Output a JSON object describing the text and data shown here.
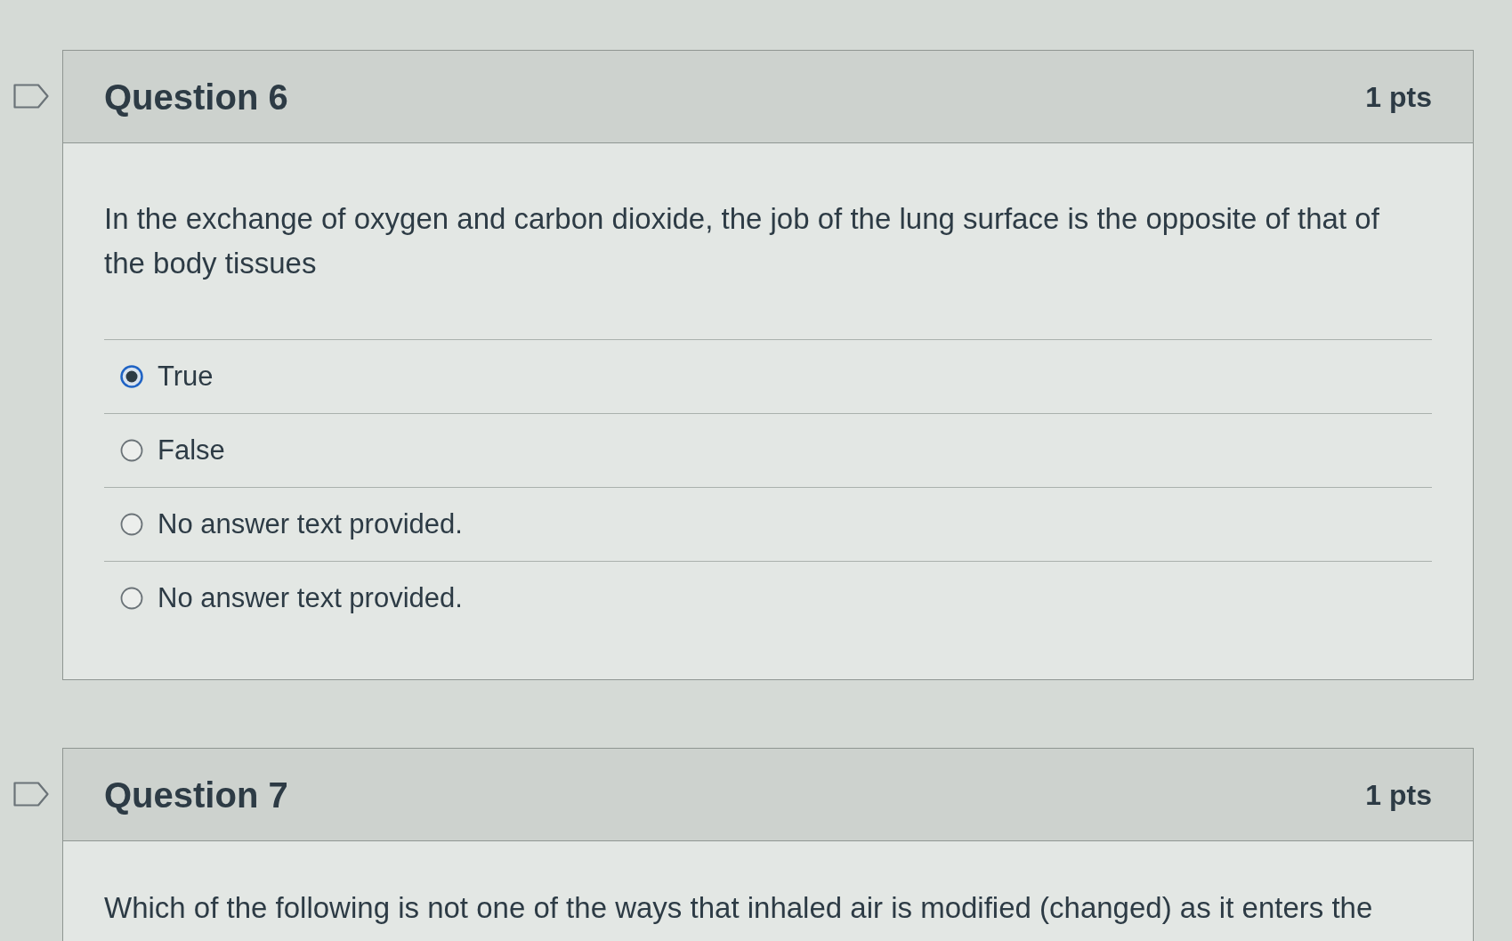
{
  "questions": [
    {
      "title": "Question 6",
      "points": "1 pts",
      "flagged": false,
      "text": "In the exchange of oxygen and carbon dioxide, the job of the lung surface is the opposite of that of the body tissues",
      "answers": [
        {
          "label": "True",
          "selected": true
        },
        {
          "label": "False",
          "selected": false
        },
        {
          "label": "No answer text provided.",
          "selected": false
        },
        {
          "label": "No answer text provided.",
          "selected": false
        }
      ]
    },
    {
      "title": "Question 7",
      "points": "1 pts",
      "flagged": false,
      "text": "Which of the following is not one of the ways that inhaled air is modified (changed) as it enters the"
    }
  ]
}
